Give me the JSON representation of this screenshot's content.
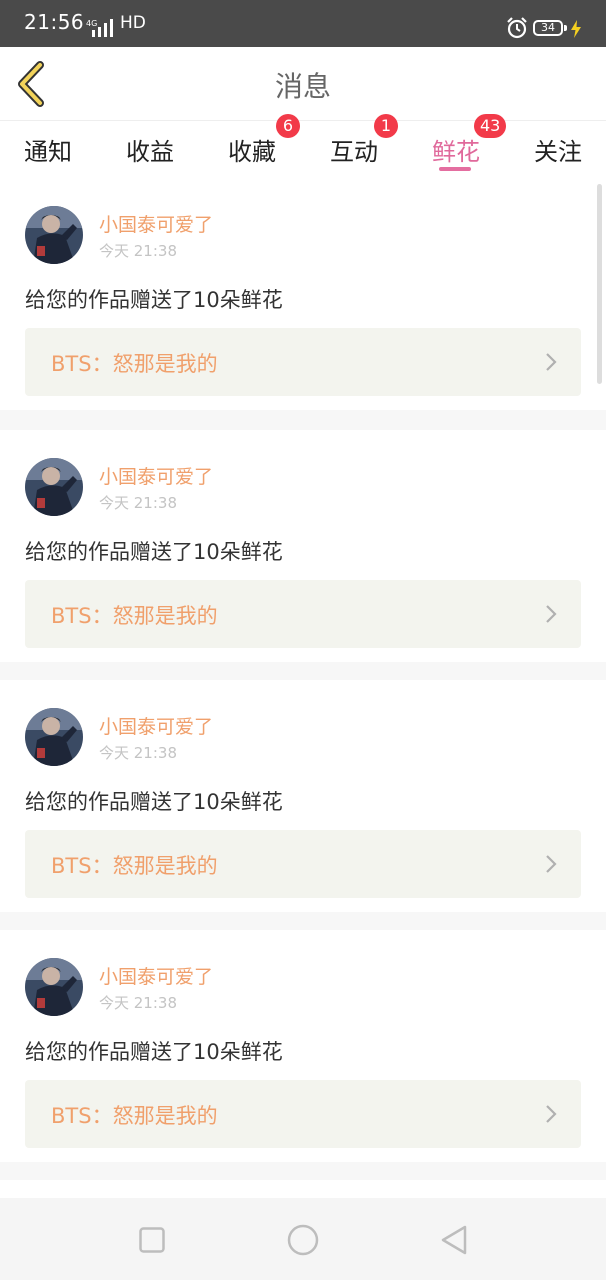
{
  "status_bar": {
    "time": "21:56",
    "network": "4G",
    "hd": "HD",
    "battery": "34",
    "icons": [
      "signal-icon",
      "alarm-icon",
      "battery-icon",
      "charging-icon"
    ]
  },
  "header": {
    "title": "消息",
    "back_icon": "chevron-left-icon"
  },
  "tabs": [
    {
      "label": "通知",
      "badge": ""
    },
    {
      "label": "收益",
      "badge": ""
    },
    {
      "label": "收藏",
      "badge": "6"
    },
    {
      "label": "互动",
      "badge": "1"
    },
    {
      "label": "鲜花",
      "badge": "43",
      "active": true
    },
    {
      "label": "关注",
      "badge": ""
    }
  ],
  "messages": [
    {
      "user": "小国泰可爱了",
      "time": "今天 21:38",
      "text": "给您的作品赠送了10朵鲜花",
      "work": "BTS：怒那是我的"
    },
    {
      "user": "小国泰可爱了",
      "time": "今天 21:38",
      "text": "给您的作品赠送了10朵鲜花",
      "work": "BTS：怒那是我的"
    },
    {
      "user": "小国泰可爱了",
      "time": "今天 21:38",
      "text": "给您的作品赠送了10朵鲜花",
      "work": "BTS：怒那是我的"
    },
    {
      "user": "小国泰可爱了",
      "time": "今天 21:38",
      "text": "给您的作品赠送了10朵鲜花",
      "work": "BTS：怒那是我的"
    }
  ],
  "nav_bar": {
    "buttons": [
      "recent-apps-icon",
      "home-icon",
      "back-triangle-icon"
    ]
  },
  "colors": {
    "accent_pink": "#e0699b",
    "username_orange": "#f0a06c",
    "badge_red": "#f23a49",
    "status_bar_bg": "#4a4a4a"
  }
}
